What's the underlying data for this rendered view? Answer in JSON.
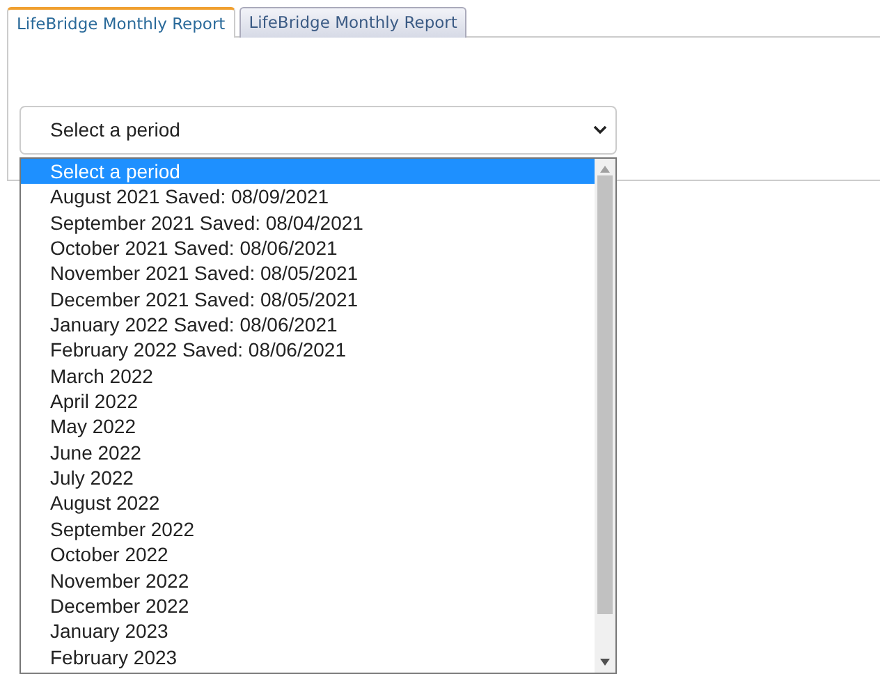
{
  "tabs": [
    {
      "label": "LifeBridge Monthly Report",
      "selected": true
    },
    {
      "label": "LifeBridge Monthly Report",
      "selected": false
    }
  ],
  "period_select": {
    "value": "Select a period",
    "expanded": true
  },
  "options": [
    {
      "label": "Select a period",
      "selected": true
    },
    {
      "label": "August 2021 Saved: 08/09/2021",
      "selected": false
    },
    {
      "label": "September 2021 Saved: 08/04/2021",
      "selected": false
    },
    {
      "label": "October 2021 Saved: 08/06/2021",
      "selected": false
    },
    {
      "label": "November 2021 Saved: 08/05/2021",
      "selected": false
    },
    {
      "label": "December 2021 Saved: 08/05/2021",
      "selected": false
    },
    {
      "label": "January 2022 Saved: 08/06/2021",
      "selected": false
    },
    {
      "label": "February 2022 Saved: 08/06/2021",
      "selected": false
    },
    {
      "label": "March 2022",
      "selected": false
    },
    {
      "label": "April 2022",
      "selected": false
    },
    {
      "label": "May 2022",
      "selected": false
    },
    {
      "label": "June 2022",
      "selected": false
    },
    {
      "label": "July 2022",
      "selected": false
    },
    {
      "label": "August 2022",
      "selected": false
    },
    {
      "label": "September 2022",
      "selected": false
    },
    {
      "label": "October 2022",
      "selected": false
    },
    {
      "label": "November 2022",
      "selected": false
    },
    {
      "label": "December 2022",
      "selected": false
    },
    {
      "label": "January 2023",
      "selected": false
    },
    {
      "label": "February 2023",
      "selected": false
    }
  ]
}
